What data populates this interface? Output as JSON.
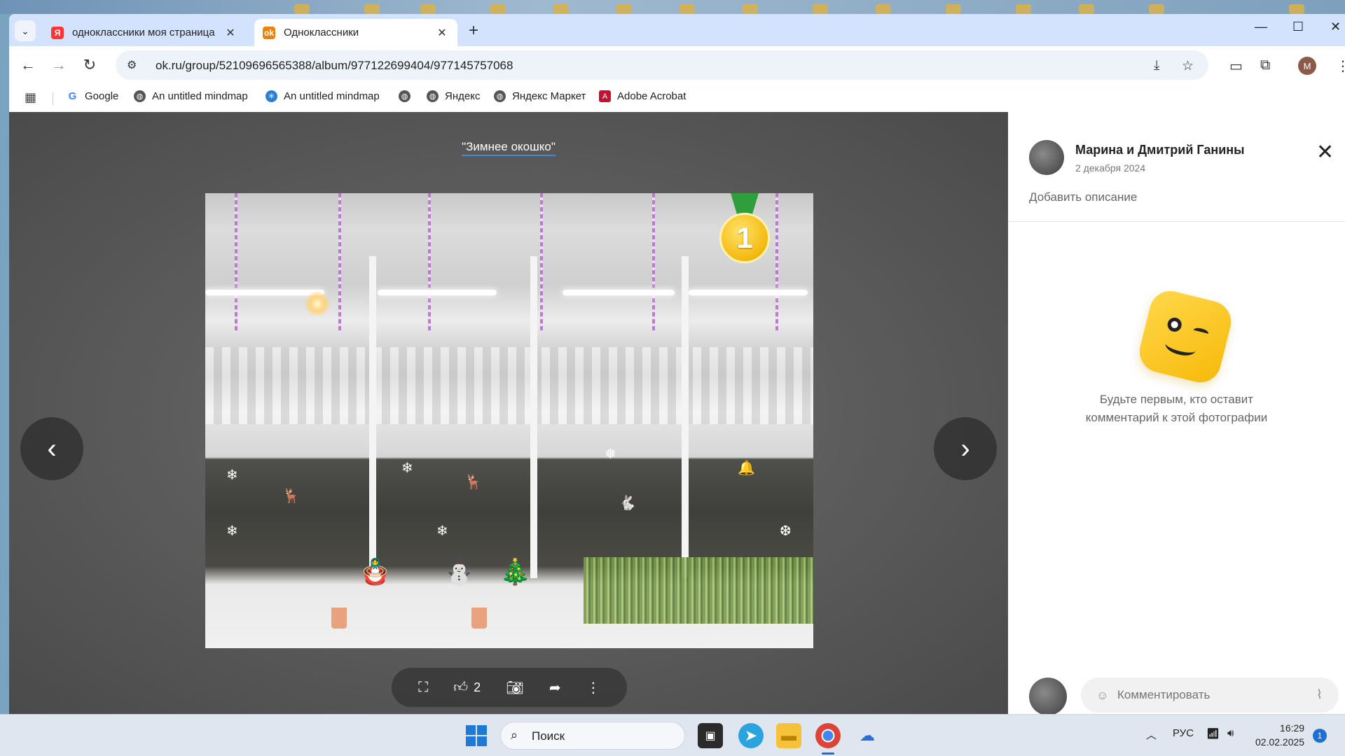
{
  "browser": {
    "tabs": [
      {
        "title": "одноклассники моя страница",
        "favicon": "yandex-icon",
        "active": false
      },
      {
        "title": "Одноклассники",
        "favicon": "ok-icon",
        "active": true
      }
    ],
    "url": "ok.ru/group/52109696565388/album/977122699404/977145757068",
    "profile_initial": "M",
    "bookmarks": [
      {
        "label": "Google",
        "icon": "google-icon"
      },
      {
        "label": "An untitled mindmap",
        "icon": "globe-icon"
      },
      {
        "label": "An untitled mindmap",
        "icon": "mindmap-icon"
      },
      {
        "label": "",
        "icon": "globe-icon"
      },
      {
        "label": "Яндекс",
        "icon": "globe-icon"
      },
      {
        "label": "Яндекс Маркет",
        "icon": "globe-icon"
      },
      {
        "label": "Adobe Acrobat",
        "icon": "acrobat-icon"
      }
    ]
  },
  "viewer": {
    "album_title": "\"Зимнее окошко\"",
    "medal_number": "1",
    "likes": "2"
  },
  "side": {
    "author_name": "Марина и Дмитрий Ганины",
    "date": "2 декабря 2024",
    "add_description": "Добавить описание",
    "empty_line1": "Будьте первым, кто оставит",
    "empty_line2": "комментарий к этой фотографии",
    "comment_placeholder": "Комментировать"
  },
  "taskbar": {
    "search_label": "Поиск",
    "language": "РУС",
    "time": "16:29",
    "date": "02.02.2025",
    "notifications": "1"
  },
  "colors": {
    "tab_strip": "#d3e3fd",
    "ok_orange": "#ee8208",
    "link_underline": "#3d8bd8",
    "medal_gold": "#f4b90e",
    "medal_ribbon": "#2f9e3c"
  }
}
